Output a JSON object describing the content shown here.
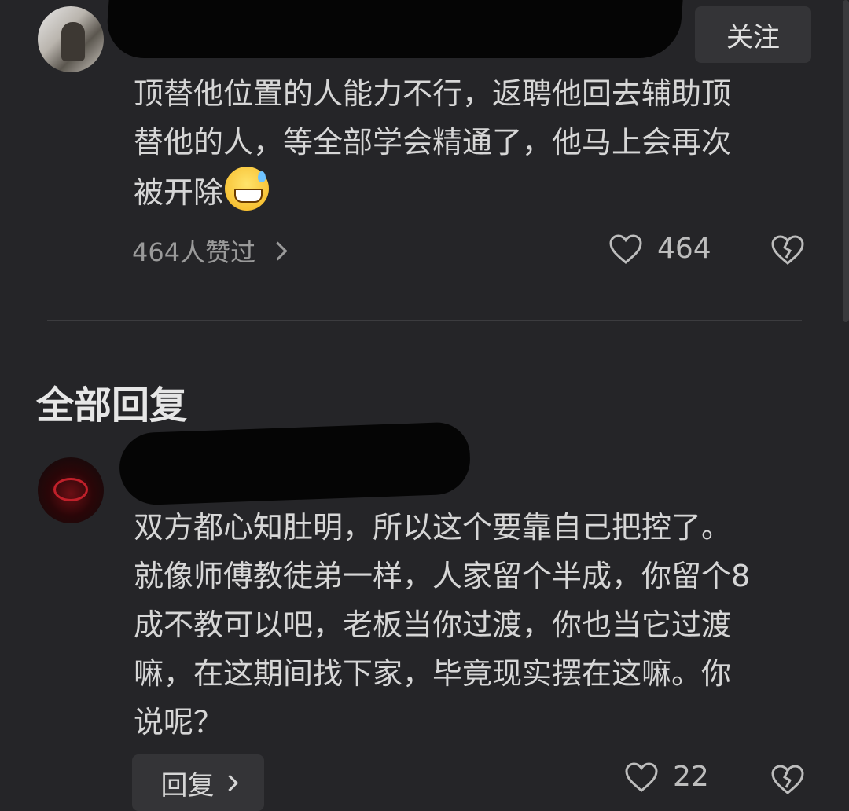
{
  "comment": {
    "follow_label": "关注",
    "text": "顶替他位置的人能力不行，返聘他回去辅助顶\n替他的人，等全部学会精通了，他马上会再次\n被开除",
    "emoji": "grinning-sweat-emoji",
    "likers_label": "464人赞过",
    "like_count": "464"
  },
  "replies_section": {
    "title": "全部回复"
  },
  "reply": {
    "text": "双方都心知肚明，所以这个要靠自己把控了。\n就像师傅教徒弟一样，人家留个半成，你留个8\n成不教可以吧，老板当你过渡，你也当它过渡\n嘛，在这期间找下家，毕竟现实摆在这嘛。你\n说呢？",
    "reply_button_label": "回复",
    "like_count": "22"
  },
  "colors": {
    "background": "#252528",
    "button_bg": "#343437",
    "text": "#d6d6d6",
    "muted": "#9a9a9a"
  }
}
